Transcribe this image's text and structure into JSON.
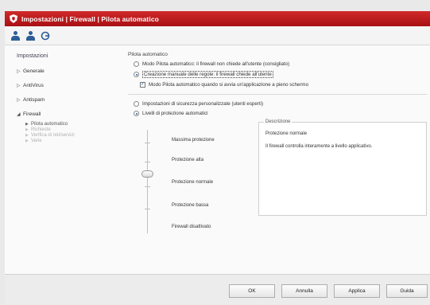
{
  "window": {
    "title": "Impostazioni | Firewall | Pilota automatico"
  },
  "toolbar": {
    "icons": [
      "user-icon",
      "user-icon",
      "help-icon"
    ]
  },
  "sidebar": {
    "title": "Impostazioni",
    "items": [
      {
        "label": "Generale"
      },
      {
        "label": "AntiVirus"
      },
      {
        "label": "Antispam"
      },
      {
        "label": "Firewall"
      }
    ],
    "firewall_sub": [
      {
        "label": "Pilota automatico",
        "enabled": true
      },
      {
        "label": "Richieste",
        "enabled": false
      },
      {
        "label": "Verifica di reti/servizi",
        "enabled": false
      },
      {
        "label": "Varie",
        "enabled": false
      }
    ]
  },
  "main": {
    "section_autopilot": "Pilota automatico",
    "opt_auto": "Modo Pilota automatico: il firewall non chiede all'utente (consigliato)",
    "opt_manual": "Creazione manuale delle regole: il firewall chiede all'utente",
    "opt_fullscreen": "Modo Pilota automatico quando si avvia un'applicazione a pieno schermo",
    "opt_custom_security": "Impostazioni di sicurezza personalizzate (utenti esperti)",
    "opt_auto_levels": "Livelli di protezione automatici",
    "levels": [
      "Massima protezione",
      "Protezione alta",
      "Protezione normale",
      "Protezione bassa",
      "Firewall disattivato"
    ],
    "selected_level_index": 2,
    "description": {
      "title": "Descrizione",
      "level_name": "Protezione normale",
      "text": "Il firewall controlla interamente a livello applicativo."
    }
  },
  "footer": {
    "ok": "OK",
    "cancel": "Annulla",
    "apply": "Applica",
    "help": "Guida"
  }
}
